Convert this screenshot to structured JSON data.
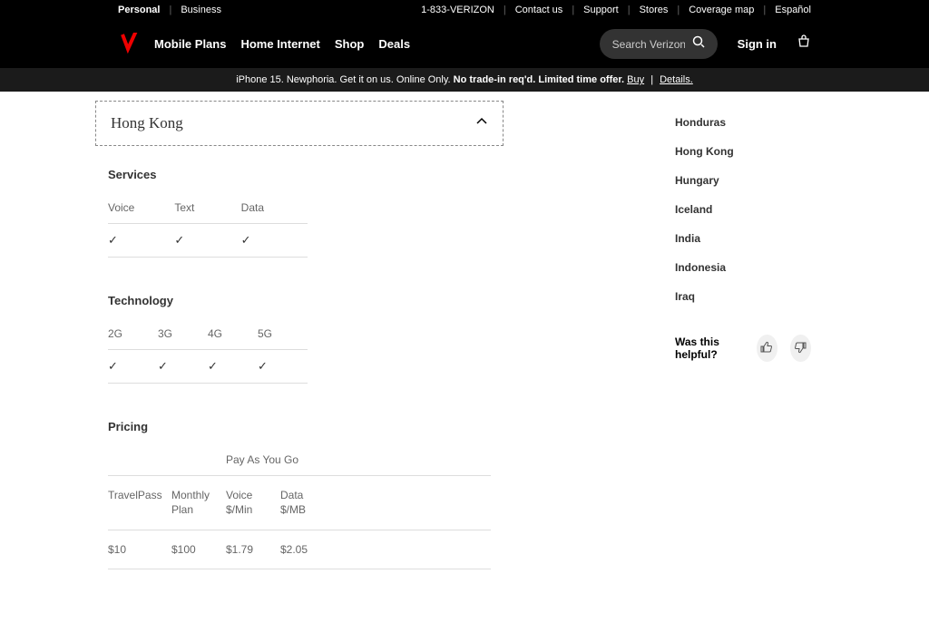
{
  "topbar": {
    "personal": "Personal",
    "business": "Business",
    "phone": "1-833-VERIZON",
    "contact": "Contact us",
    "support": "Support",
    "stores": "Stores",
    "coverage": "Coverage map",
    "espanol": "Español"
  },
  "nav": {
    "mobile_plans": "Mobile Plans",
    "home_internet": "Home Internet",
    "shop": "Shop",
    "deals": "Deals",
    "search_placeholder": "Search Verizon",
    "signin": "Sign in"
  },
  "promo": {
    "text1": "iPhone 15. Newphoria. Get it on us. Online Only. ",
    "text2": "No trade-in req'd. Limited time offer.",
    "buy": "Buy",
    "sep": "|",
    "details": "Details."
  },
  "accordion": {
    "title": "Hong Kong"
  },
  "services": {
    "title": "Services",
    "headers": [
      "Voice",
      "Text",
      "Data"
    ],
    "row": [
      "✓",
      "✓",
      "✓"
    ]
  },
  "technology": {
    "title": "Technology",
    "headers": [
      "2G",
      "3G",
      "4G",
      "5G"
    ],
    "row": [
      "✓",
      "✓",
      "✓",
      "✓"
    ]
  },
  "pricing": {
    "title": "Pricing",
    "payg": "Pay As You Go",
    "headers": {
      "travelpass": "TravelPass",
      "monthly": "Monthly\nPlan",
      "voice": "Voice\n$/Min",
      "data": "Data\n$/MB"
    },
    "values": {
      "travelpass": "$10",
      "monthly": "$100",
      "voice": "$1.79",
      "data": "$2.05"
    }
  },
  "countries": [
    "Honduras",
    "Hong Kong",
    "Hungary",
    "Iceland",
    "India",
    "Indonesia",
    "Iraq"
  ],
  "helpful": "Was this helpful?"
}
